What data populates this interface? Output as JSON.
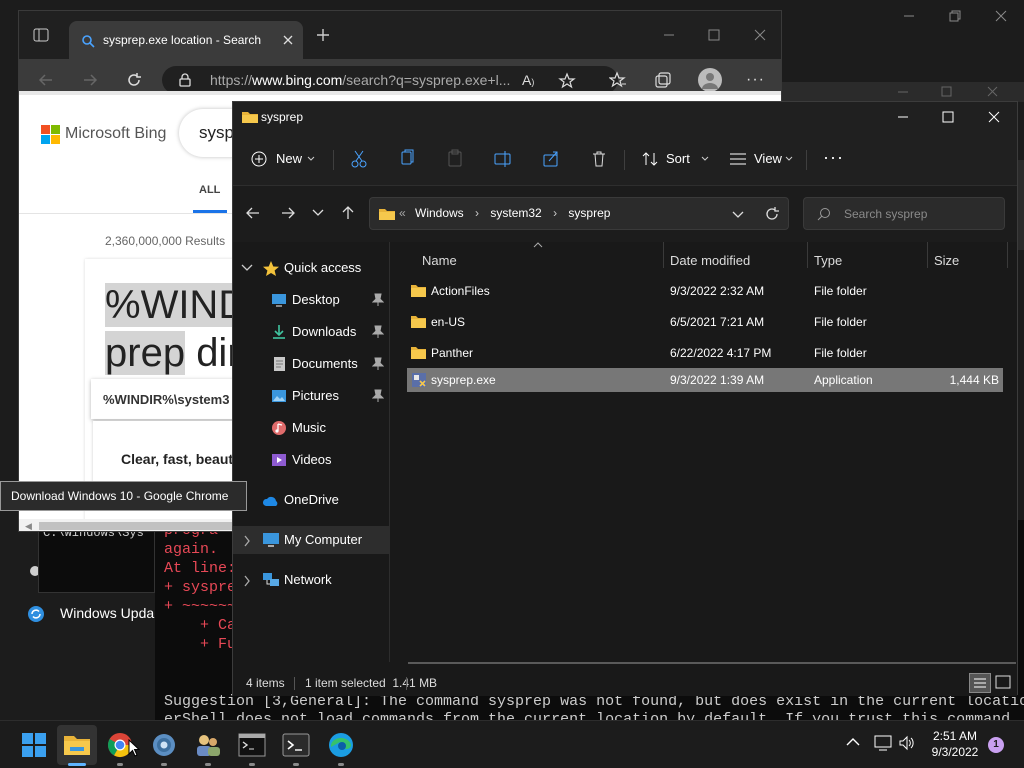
{
  "desktop": {
    "windows_update_label": "Windows Upda"
  },
  "chrome": {
    "tab_title": "sysprep.exe location - Search",
    "url_prefix": "https://",
    "url_host": "www.bing.com",
    "url_rest": "/search?q=sysprep.exe+l...",
    "page": {
      "logo_text": "Microsoft Bing",
      "search_text": "sysp",
      "tab_all": "ALL",
      "results_count": "2,360,000,000 Results",
      "answer_line1": "%WIND",
      "answer_line2_a": "prep",
      "answer_line2_b": "dir",
      "path_snippet": "%WINDIR%\\system3",
      "ad_text": "Clear, fast, beaut"
    }
  },
  "tooltip": {
    "text": "Download Windows 10 - Google Chrome"
  },
  "powershell": {
    "path_line": "C:\\Windows\\Sys",
    "lines": [
      "progra",
      "again.",
      "At line:",
      "+ sysprep",
      "+ ~~~~~~",
      "    + Ca",
      "    + Fu"
    ],
    "suggestion": "Suggestion [3,General]: The command sysprep was not found, but does exist in the current locatio",
    "suggestion2": "erShell does not load commands from the current location by default. If you trust this command,"
  },
  "explorer": {
    "title": "sysprep",
    "toolbar": {
      "new_label": "New",
      "sort_label": "Sort",
      "view_label": "View"
    },
    "breadcrumb": [
      "Windows",
      "system32",
      "sysprep"
    ],
    "search_placeholder": "Search sysprep",
    "nav": {
      "quick_access": "Quick access",
      "items": [
        {
          "label": "Desktop",
          "icon": "desktop-icon",
          "pinned": true
        },
        {
          "label": "Downloads",
          "icon": "downloads-icon",
          "pinned": true
        },
        {
          "label": "Documents",
          "icon": "documents-icon",
          "pinned": true
        },
        {
          "label": "Pictures",
          "icon": "pictures-icon",
          "pinned": true
        },
        {
          "label": "Music",
          "icon": "music-icon",
          "pinned": false
        },
        {
          "label": "Videos",
          "icon": "videos-icon",
          "pinned": false
        }
      ],
      "onedrive": "OneDrive",
      "my_computer": "My Computer",
      "network": "Network"
    },
    "columns": [
      "Name",
      "Date modified",
      "Type",
      "Size"
    ],
    "files": [
      {
        "name": "ActionFiles",
        "date": "9/3/2022 2:32 AM",
        "type": "File folder",
        "size": ""
      },
      {
        "name": "en-US",
        "date": "6/5/2021 7:21 AM",
        "type": "File folder",
        "size": ""
      },
      {
        "name": "Panther",
        "date": "6/22/2022 4:17 PM",
        "type": "File folder",
        "size": ""
      },
      {
        "name": "sysprep.exe",
        "date": "9/3/2022 1:39 AM",
        "type": "Application",
        "size": "1,444 KB"
      }
    ],
    "status": {
      "item_count": "4 items",
      "selection": "1 item selected  1.41 MB"
    }
  },
  "taskbar": {
    "time": "2:51 AM",
    "date": "9/3/2022",
    "notification_count": "1"
  }
}
